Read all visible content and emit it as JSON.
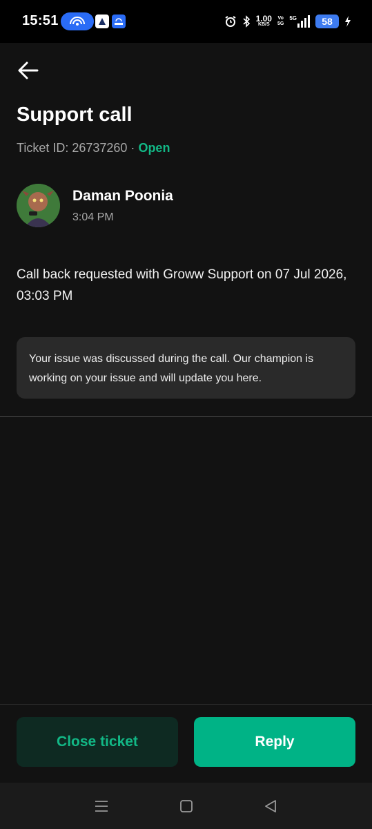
{
  "status_bar": {
    "time": "15:51",
    "net_speed_value": "1.00",
    "net_speed_unit": "KB/S",
    "volte_top": "Vo",
    "volte_bottom": "5G",
    "network_type": "5G",
    "battery": "58"
  },
  "header": {
    "title": "Support call",
    "ticket_label": "Ticket ID: 26737260 · ",
    "ticket_status": "Open"
  },
  "message": {
    "author": "Daman Poonia",
    "time": "3:04 PM",
    "text": "Call back requested with Groww Support on 07 Jul 2026, 03:03 PM",
    "info_card": "Your issue was discussed during the call. Our champion is working on your issue and will update you here."
  },
  "footer": {
    "close_label": "Close ticket",
    "reply_label": "Reply"
  },
  "icons": {
    "back": "back-arrow-icon",
    "nav_menu": "menu-icon",
    "nav_home": "home-icon",
    "nav_back": "nav-back-icon"
  },
  "colors": {
    "background": "#121212",
    "accent": "#00b386",
    "status_open": "#12b886",
    "close_button_bg": "#0e2a22",
    "card_bg": "#2a2a2a"
  }
}
